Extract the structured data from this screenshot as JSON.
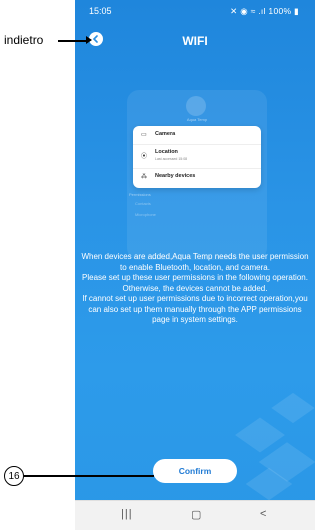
{
  "status": {
    "time": "15:05",
    "icons": "✕ ◉ ≈ .ıl 100% ▮"
  },
  "header": {
    "title": "WIFI",
    "back_icon": "chevron-left-icon"
  },
  "illustration": {
    "head": "Aqua Temp",
    "sub": "Permissions",
    "permissions": [
      {
        "icon": "camera-icon",
        "label": "Camera",
        "sub": ""
      },
      {
        "icon": "location-icon",
        "label": "Location",
        "sub": "Last accessed 15:08"
      },
      {
        "icon": "nearby-devices-icon",
        "label": "Nearby devices",
        "sub": ""
      }
    ],
    "faded": [
      "Contacts",
      "Microphone"
    ]
  },
  "message": [
    "When devices are added,Aqua Temp needs the user permission to enable Bluetooth, location, and camera.",
    "Please set up these user permissions in the following operation.",
    "Otherwise, the devices cannot be added.",
    "If cannot set up user permissions due to incorrect operation,you can also set up them manually through the APP permissions page in system settings."
  ],
  "confirm_label": "Confirm",
  "annotations": {
    "back": "indietro",
    "confirm_marker": "16"
  },
  "nav": {
    "recents": "|||",
    "home": "▢",
    "back": "<"
  },
  "colors": {
    "background": "#2a94e6",
    "button_text": "#1f7ad4"
  }
}
